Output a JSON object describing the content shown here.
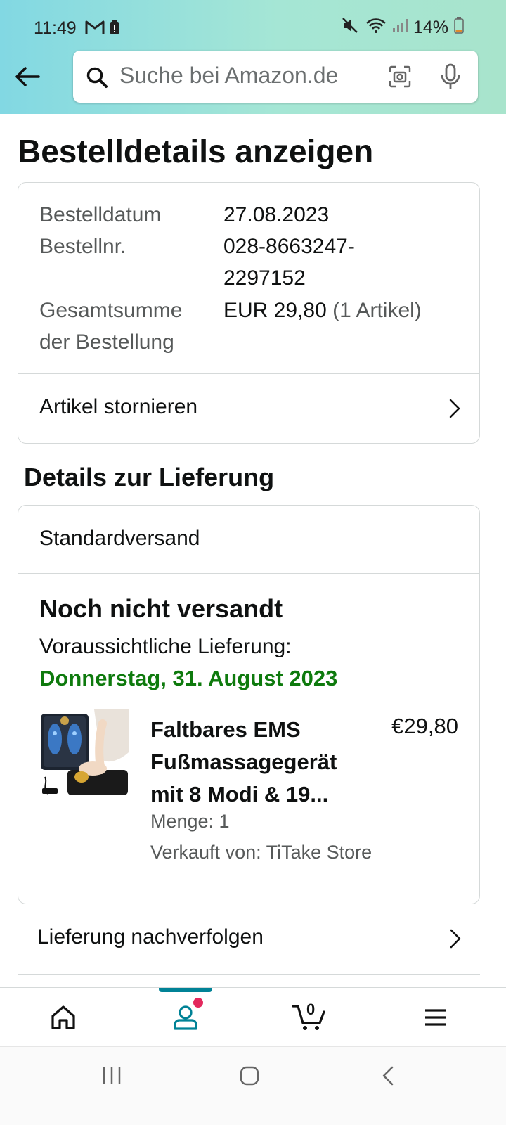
{
  "status_bar": {
    "time": "11:49",
    "battery": "14%",
    "icons": [
      "gmail-icon",
      "notification-icon",
      "mute-icon",
      "wifi-icon",
      "signal-icon",
      "battery-icon"
    ]
  },
  "header": {
    "search_placeholder": "Suche bei Amazon.de",
    "icons": [
      "back-arrow-icon",
      "search-icon",
      "camera-scan-icon",
      "microphone-icon"
    ]
  },
  "page": {
    "title": "Bestelldetails anzeigen"
  },
  "order": {
    "date_label": "Bestelldatum",
    "date_value": "27.08.2023",
    "number_label": "Bestellnr.",
    "number_value_line1": "028-8663247-",
    "number_value_line2": "2297152",
    "total_label_line1": "Gesamtsumme",
    "total_label_line2": "der Bestellung",
    "total_value": "EUR 29,80",
    "total_items": "(1 Artikel)",
    "cancel_label": "Artikel stornieren"
  },
  "delivery": {
    "section_title": "Details zur Lieferung",
    "shipping_type": "Standardversand",
    "status": "Noch nicht versandt",
    "eta_label": "Voraussichtliche Lieferung:",
    "eta_date": "Donnerstag, 31. August 2023",
    "track_label": "Lieferung nachverfolgen"
  },
  "product": {
    "title": "Faltbares EMS Fußmassagegerät mit 8 Modi & 19...",
    "price": "€29,80",
    "quantity": "Menge: 1",
    "seller": "Verkauft von: TiTake Store"
  },
  "bottom_nav": {
    "cart_count": "0",
    "items": [
      "home-icon",
      "account-icon",
      "cart-icon",
      "menu-icon"
    ],
    "active": "account-icon"
  },
  "colors": {
    "header_gradient_start": "#82d8e3",
    "header_gradient_end": "#a8e4cc",
    "delivery_green": "#0e7a0d",
    "nav_accent": "#008296",
    "badge_dot": "#e3285d"
  }
}
